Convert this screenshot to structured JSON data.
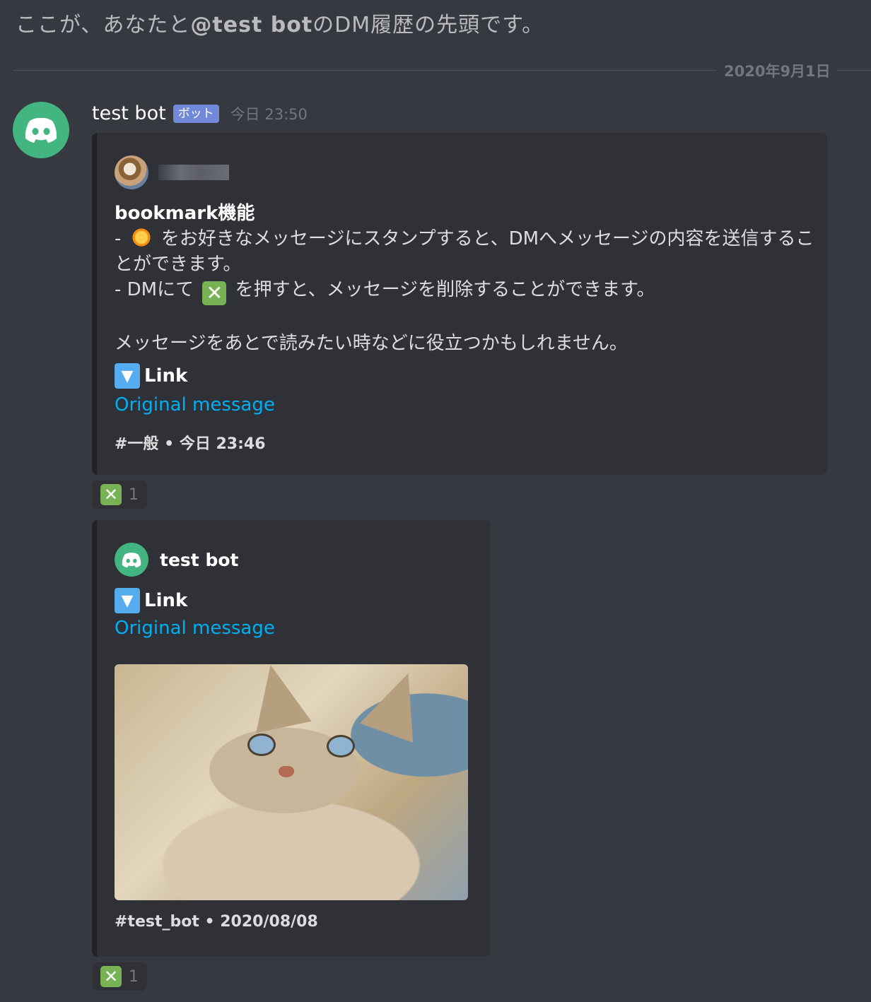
{
  "intro": {
    "prefix": "ここが、あなたと",
    "mention": "@test bot",
    "suffix": "のDM履歴の先頭です。"
  },
  "divider": {
    "date": "2020年9月1日"
  },
  "message": {
    "author": "test bot",
    "bot_tag": "ボット",
    "timestamp": "今日 23:50",
    "avatar_icon": "discord-logo-icon",
    "avatar_color": "#43b581"
  },
  "embed1": {
    "author_avatar_icon": "coffee-avatar",
    "author_name_redacted": true,
    "title": "bookmark機能",
    "line1_prefix": "- ",
    "line1_suffix": " をお好きなメッセージにスタンプすると、DMへメッセージの内容を送信することができます。",
    "line2_prefix": "- DMにて ",
    "line2_suffix": " を押すと、メッセージを削除することができます。",
    "line3": "メッセージをあとで読みたい時などに役立つかもしれません。",
    "field_name": "Link",
    "field_value": "Original message",
    "footer": "#一般 • 今日 23:46"
  },
  "reaction1": {
    "emoji": "✕",
    "count": "1"
  },
  "embed2": {
    "author_name": "test bot",
    "field_name": "Link",
    "field_value": "Original message",
    "image_alt": "cat-photo",
    "footer": "#test_bot • 2020/08/08"
  },
  "reaction2": {
    "emoji": "✕",
    "count": "1"
  },
  "colors": {
    "background": "#36393f",
    "embed_bg": "#2f3136",
    "link": "#00b0f4",
    "bot_tag": "#7289da",
    "reaction_x": "#77b255"
  }
}
